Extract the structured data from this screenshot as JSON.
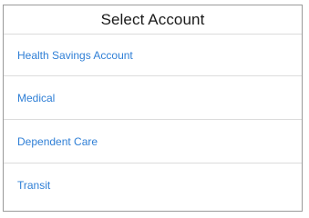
{
  "colors": {
    "accent": "#2f7fd6",
    "title": "#1a1a1a",
    "divider": "#dcdcdc",
    "border": "#9a9a9a"
  },
  "dialog": {
    "title": "Select Account",
    "items": [
      {
        "label": "Health Savings Account"
      },
      {
        "label": "Medical"
      },
      {
        "label": "Dependent Care"
      },
      {
        "label": "Transit"
      }
    ]
  }
}
